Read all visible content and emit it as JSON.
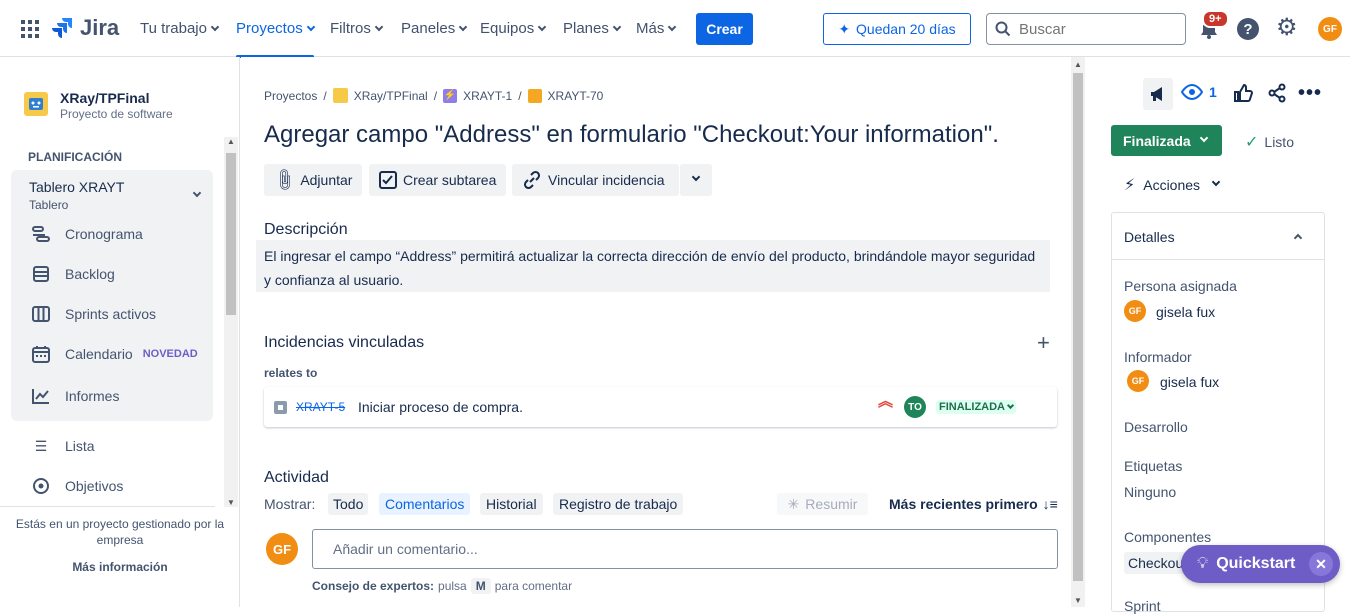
{
  "topbar": {
    "app_name": "Jira",
    "nav": [
      "Tu trabajo",
      "Proyectos",
      "Filtros",
      "Paneles",
      "Equipos",
      "Planes",
      "Más"
    ],
    "create": "Crear",
    "trial": "Quedan 20 días",
    "search_placeholder": "Buscar",
    "notif_badge": "9+",
    "user_initials": "GF"
  },
  "sidebar": {
    "project_name": "XRay/TPFinal",
    "project_type": "Proyecto de software",
    "section": "PLANIFICACIÓN",
    "board_name": "Tablero XRAYT",
    "board_sub": "Tablero",
    "items": [
      "Cronograma",
      "Backlog",
      "Sprints activos",
      "Calendario",
      "Informes",
      "Lista",
      "Objetivos"
    ],
    "new_badge": "NOVEDAD",
    "footer_text": "Estás en un proyecto gestionado por la empresa",
    "footer_link": "Más información"
  },
  "issue": {
    "breadcrumb": [
      "Proyectos",
      "XRay/TPFinal",
      "XRAYT-1",
      "XRAYT-70"
    ],
    "title": "Agregar campo \"Address\" en formulario \"Checkout:Your information\".",
    "actions": [
      "Adjuntar",
      "Crear subtarea",
      "Vincular incidencia"
    ],
    "description_heading": "Descripción",
    "description": "El ingresar el campo “Address” permitirá actualizar la correcta dirección de envío del producto, brindándole mayor seguridad y confianza al usuario.",
    "linked_heading": "Incidencias vinculadas",
    "relation": "relates to",
    "linked_key": "XRAYT-5",
    "linked_summary": "Iniciar proceso de compra.",
    "linked_assignee": "TO",
    "linked_status": "FINALIZADA",
    "activity_heading": "Actividad",
    "show_label": "Mostrar:",
    "activity_tabs": [
      "Todo",
      "Comentarios",
      "Historial",
      "Registro de trabajo"
    ],
    "summarize": "Resumir",
    "sort": "Más recientes primero",
    "comment_placeholder": "Añadir un comentario...",
    "tip_bold": "Consejo de expertos:",
    "tip_pre": "pulsa",
    "tip_key": "M",
    "tip_post": "para comentar"
  },
  "details": {
    "watchers": "1",
    "status": "Finalizada",
    "resolution": "Listo",
    "actions": "Acciones",
    "panel_title": "Detalles",
    "assignee_label": "Persona asignada",
    "assignee": "gisela fux",
    "reporter_label": "Informador",
    "reporter": "gisela fux",
    "development_label": "Desarrollo",
    "labels_label": "Etiquetas",
    "labels_value": "Ninguno",
    "components_label": "Componentes",
    "components_value": "Checkout",
    "sprint_label": "Sprint",
    "quickstart": "Quickstart"
  },
  "colors": {
    "accent": "#0c66e4",
    "done": "#1f845a",
    "avatar": "#f18d13",
    "quickstart": "#6e5dc6"
  }
}
